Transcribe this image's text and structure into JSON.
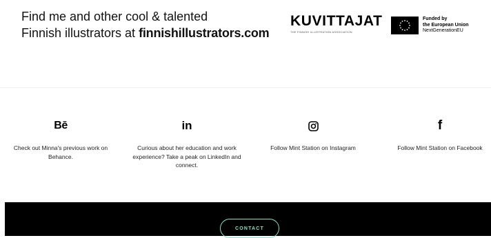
{
  "banner": {
    "line1": "Find me and other cool & talented",
    "line2_prefix": "Finnish illustrators at ",
    "line2_link": "finnishillustrators.com",
    "kuvittajat": {
      "name": "KUVITTAJAT",
      "subtitle": "THE FINNISH ILLUSTRATION ASSOCIATION"
    },
    "eu": {
      "line1": "Funded by",
      "line2": "the European Union",
      "line3": "NextGenerationEU"
    }
  },
  "social": [
    {
      "icon": "behance-icon",
      "glyph": "Bē",
      "text": "Check out Minna's previous work on Behance."
    },
    {
      "icon": "linkedin-icon",
      "glyph": "in",
      "text": "Curious about her education and work experience? Take a peak on LinkedIn and connect."
    },
    {
      "icon": "instagram-icon",
      "glyph": "",
      "text": "Follow Mint Station on Instagram"
    },
    {
      "icon": "facebook-icon",
      "glyph": "f",
      "text": "Follow Mint Station on Facebook"
    }
  ],
  "footer": {
    "contact_label": "CONTACT"
  },
  "colors": {
    "accent": "#7ee6c5",
    "footer_bg": "#000000",
    "eu_flag": "#000000"
  }
}
